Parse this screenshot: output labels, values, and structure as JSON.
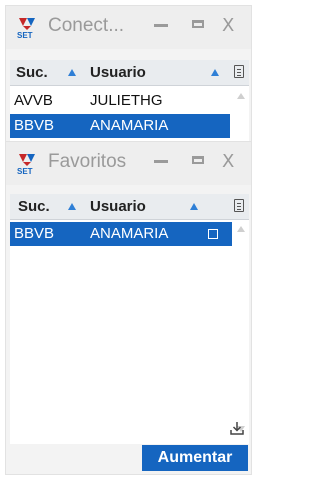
{
  "window_conectados": {
    "title": "Conect...",
    "columns": [
      "Suc.",
      "Usuario"
    ],
    "rows": [
      {
        "suc": "AVVB",
        "usuario": "JULIETHG",
        "selected": false
      },
      {
        "suc": "BBVB",
        "usuario": "ANAMARIA",
        "selected": true
      }
    ],
    "controls": {
      "minimize": "minimize-icon",
      "maximize": "maximize-icon",
      "close": "X"
    }
  },
  "window_favoritos": {
    "title": "Favoritos",
    "columns": [
      "Suc.",
      "Usuario"
    ],
    "rows": [
      {
        "suc": "BBVB",
        "usuario": "ANAMARIA",
        "selected": true
      }
    ],
    "controls": {
      "minimize": "minimize-icon",
      "maximize": "maximize-icon",
      "close": "X"
    },
    "button_label": "Aumentar"
  },
  "colors": {
    "selection": "#1565c0",
    "sort_arrow": "#2f7fd6",
    "title_text": "#9a9a9a"
  }
}
